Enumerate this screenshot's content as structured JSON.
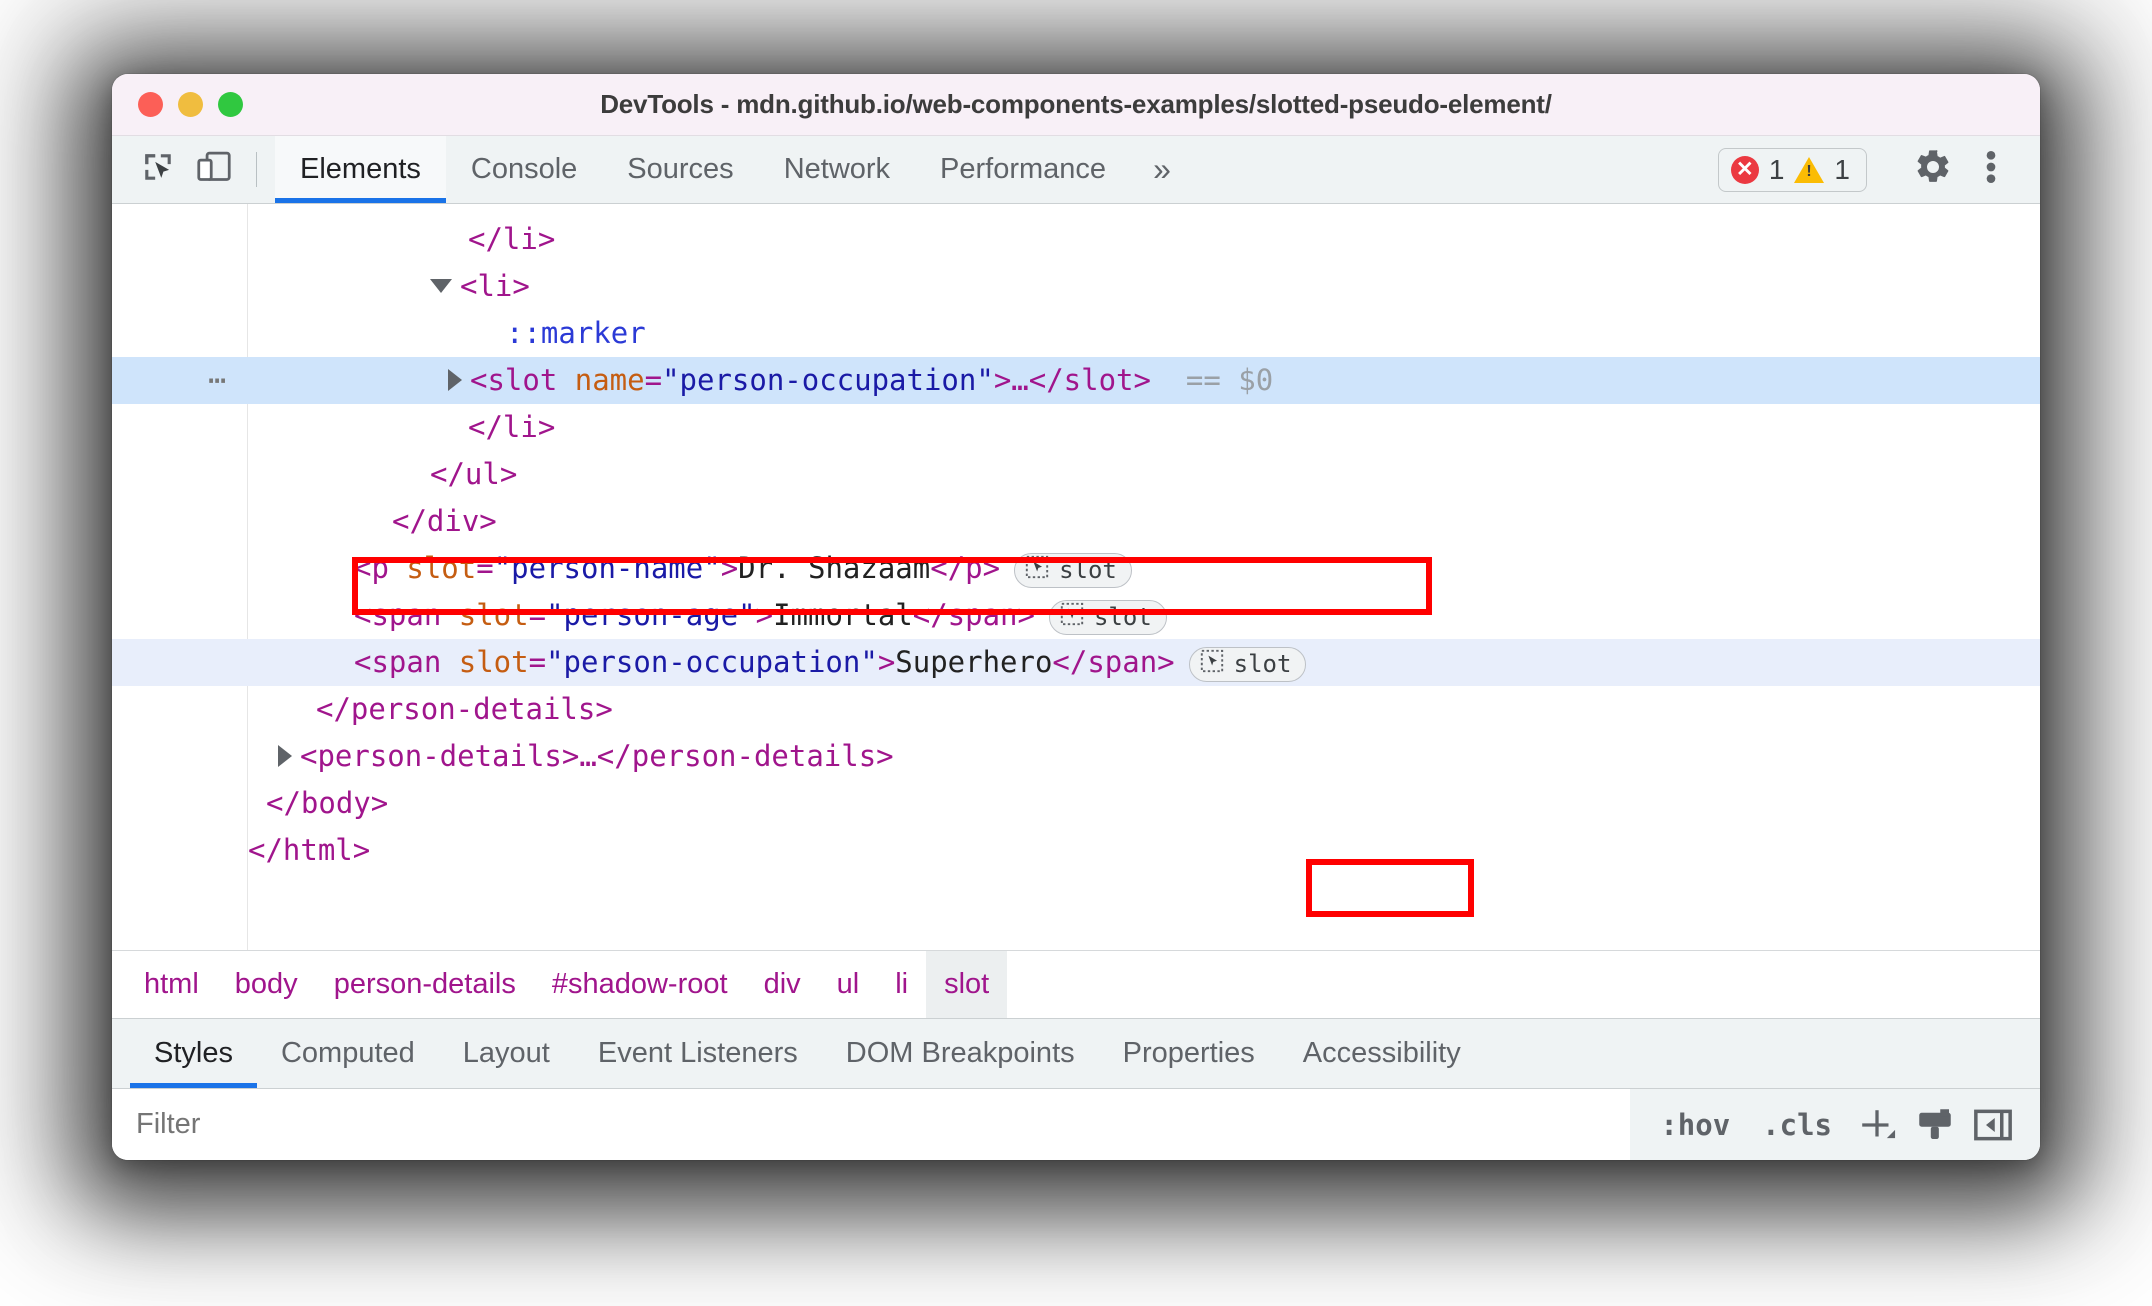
{
  "window": {
    "title": "DevTools - mdn.github.io/web-components-examples/slotted-pseudo-element/",
    "traffic_lights": [
      "close-red",
      "minimize-yellow",
      "maximize-green"
    ]
  },
  "toolbar": {
    "inspect_icon": "inspect-element-icon",
    "device_icon": "device-toolbar-icon",
    "tabs": [
      {
        "label": "Elements",
        "active": true
      },
      {
        "label": "Console",
        "active": false
      },
      {
        "label": "Sources",
        "active": false
      },
      {
        "label": "Network",
        "active": false
      },
      {
        "label": "Performance",
        "active": false
      }
    ],
    "more_tabs_label": "»",
    "errors": {
      "icon": "error-icon",
      "count": "1",
      "color": "#eb3941"
    },
    "warnings": {
      "icon": "warning-icon",
      "count": "1",
      "color": "#fbbc04"
    },
    "settings_icon": "gear-icon",
    "menu_icon": "kebab-menu-icon"
  },
  "dom_tree": {
    "rows": [
      {
        "id": "row-li-close-1",
        "indent": 220,
        "text": "</li>",
        "kind": "close-tag"
      },
      {
        "id": "row-li-open",
        "indent": 182,
        "arrow": "down",
        "text": "<li>",
        "kind": "open-tag"
      },
      {
        "id": "row-marker",
        "indent": 258,
        "text": "::marker",
        "kind": "pseudo"
      },
      {
        "id": "row-slot-selected",
        "indent": 200,
        "arrow": "right",
        "ellipsis": "…",
        "tag_open": "<slot ",
        "attr_name": "name",
        "attr_eq": "=",
        "attr_value": "\"person-occupation\"",
        "tag_close": ">…</slot>",
        "suffix": "== $0",
        "kind": "selected-node"
      },
      {
        "id": "row-li-close-2",
        "indent": 220,
        "text": "</li>",
        "kind": "close-tag"
      },
      {
        "id": "row-ul-close",
        "indent": 182,
        "text": "</ul>",
        "kind": "close-tag"
      },
      {
        "id": "row-div-close",
        "indent": 144,
        "text": "</div>",
        "kind": "close-tag"
      }
    ],
    "slotted": [
      {
        "id": "row-p-person-name",
        "indent": 106,
        "open": "<p ",
        "attr_name": "slot",
        "attr_value": "\"person-name\"",
        "content": "Dr. Shazaam",
        "close": "</p>",
        "badge": "slot"
      },
      {
        "id": "row-span-person-age",
        "indent": 106,
        "open": "<span ",
        "attr_name": "slot",
        "attr_value": "\"person-age\"",
        "content": "Immortal",
        "close": "</span>",
        "badge": "slot"
      },
      {
        "id": "row-span-person-occupation",
        "indent": 106,
        "open": "<span ",
        "attr_name": "slot",
        "attr_value": "\"person-occupation\"",
        "content": "Superhero",
        "close": "</span>",
        "badge": "slot"
      }
    ],
    "tail_rows": [
      {
        "id": "row-person-details-close",
        "indent": 68,
        "text": "</person-details>"
      },
      {
        "id": "row-person-details-collapsed",
        "indent": 30,
        "arrow": "right",
        "text": "<person-details>…</person-details>"
      },
      {
        "id": "row-body-close",
        "indent": 0,
        "text": "</body>"
      },
      {
        "id": "row-html-close",
        "indent": -38,
        "text": "</html>"
      }
    ],
    "annotation_color": "#ff0000"
  },
  "breadcrumb": {
    "items": [
      {
        "label": "html",
        "active": false
      },
      {
        "label": "body",
        "active": false
      },
      {
        "label": "person-details",
        "active": false
      },
      {
        "label": "#shadow-root",
        "active": false
      },
      {
        "label": "div",
        "active": false
      },
      {
        "label": "ul",
        "active": false
      },
      {
        "label": "li",
        "active": false
      },
      {
        "label": "slot",
        "active": true
      }
    ]
  },
  "sidebar_tabs": [
    {
      "label": "Styles",
      "active": true
    },
    {
      "label": "Computed",
      "active": false
    },
    {
      "label": "Layout",
      "active": false
    },
    {
      "label": "Event Listeners",
      "active": false
    },
    {
      "label": "DOM Breakpoints",
      "active": false
    },
    {
      "label": "Properties",
      "active": false
    },
    {
      "label": "Accessibility",
      "active": false
    }
  ],
  "filter_bar": {
    "placeholder": "Filter",
    "value": "",
    "hov_label": ":hov",
    "cls_label": ".cls",
    "new_rule_icon": "plus-icon",
    "computed_icon": "print-style-icon",
    "sidebar_toggle_icon": "toggle-sidebar-icon"
  }
}
